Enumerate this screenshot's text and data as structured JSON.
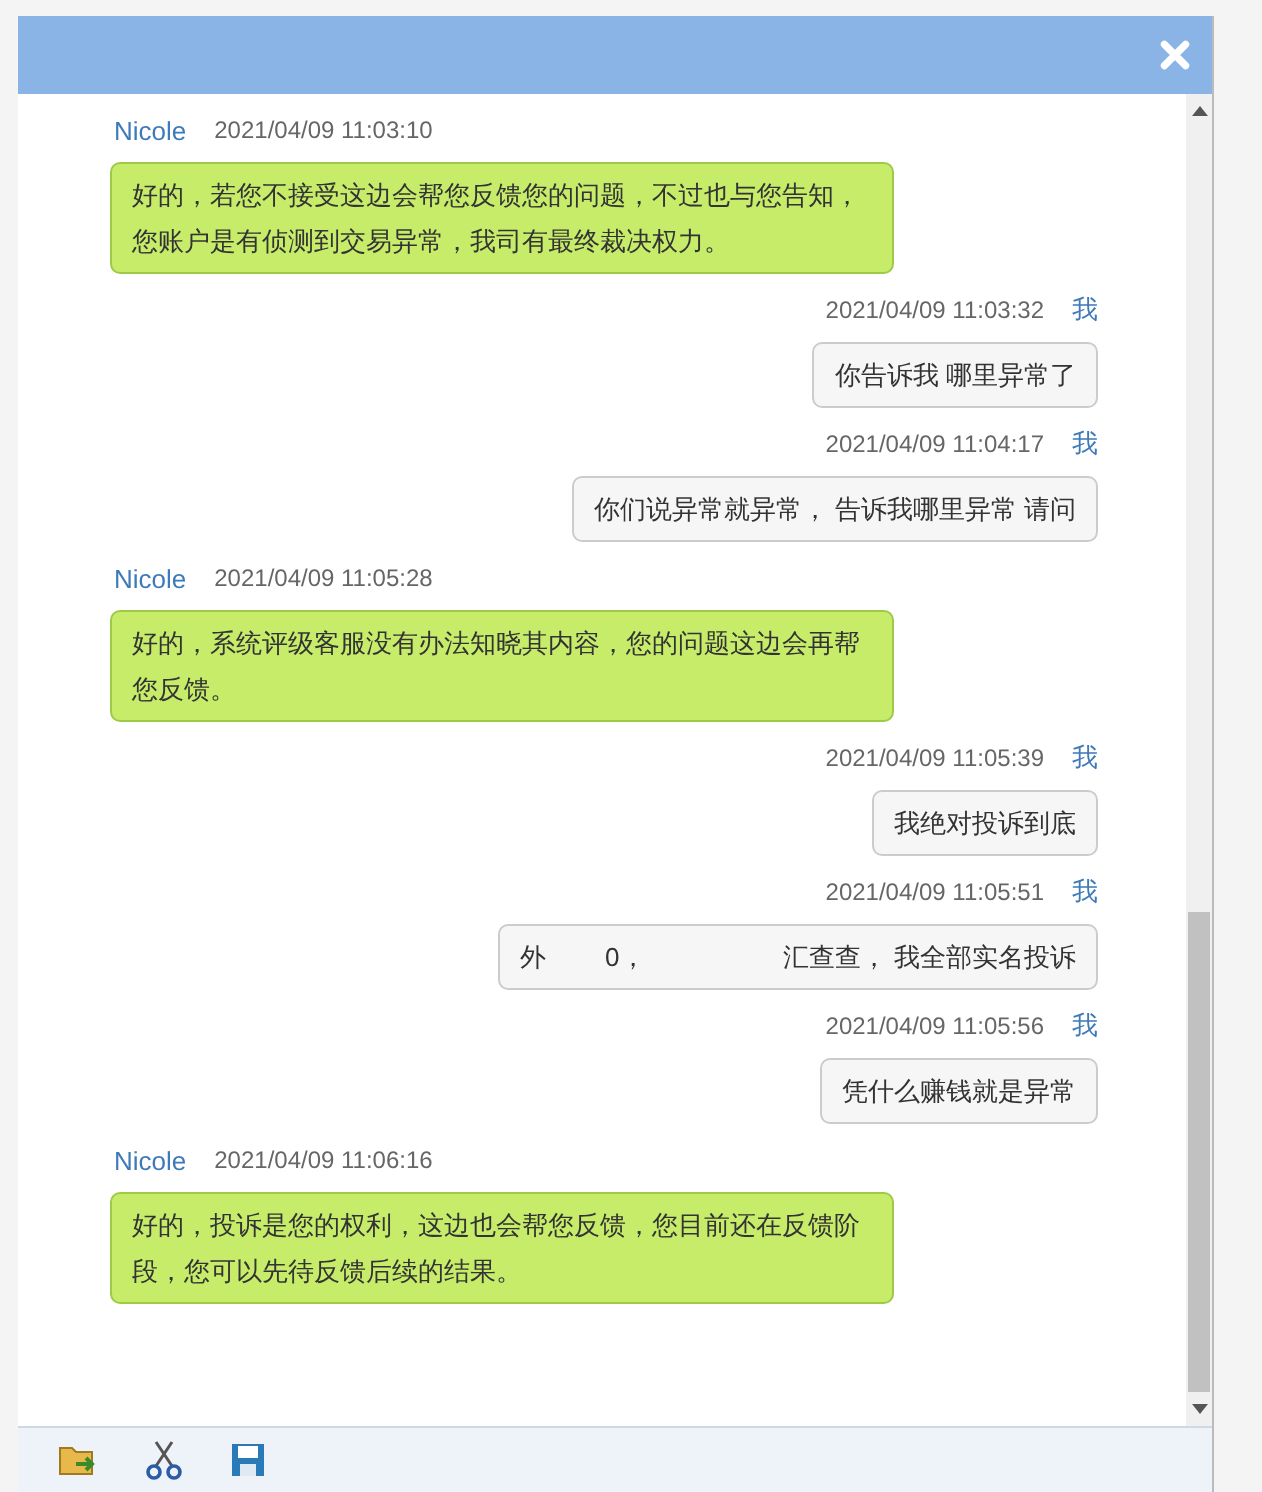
{
  "messages": [
    {
      "kind": "agent",
      "sender": "Nicole",
      "time": "2021/04/09 11:03:10",
      "text": "好的，若您不接受这边会帮您反馈您的问题，不过也与您告知，您账户是有侦测到交易异常，我司有最终裁决权力。"
    },
    {
      "kind": "me",
      "sender": "我",
      "time": "2021/04/09 11:03:32",
      "text": "你告诉我 哪里异常了"
    },
    {
      "kind": "me",
      "sender": "我",
      "time": "2021/04/09 11:04:17",
      "text": "你们说异常就异常， 告诉我哪里异常 请问"
    },
    {
      "kind": "agent",
      "sender": "Nicole",
      "time": "2021/04/09 11:05:28",
      "text": "好的，系统评级客服没有办法知晓其内容，您的问题这边会再帮您反馈。"
    },
    {
      "kind": "me",
      "sender": "我",
      "time": "2021/04/09 11:05:39",
      "text": "我绝对投诉到底"
    },
    {
      "kind": "me",
      "sender": "我",
      "time": "2021/04/09 11:05:51",
      "text": "外　　 0，　　　　　 汇查查， 我全部实名投诉"
    },
    {
      "kind": "me",
      "sender": "我",
      "time": "2021/04/09 11:05:56",
      "text": "凭什么赚钱就是异常"
    },
    {
      "kind": "agent",
      "sender": "Nicole",
      "time": "2021/04/09 11:06:16",
      "text": "好的，投诉是您的权利，这边也会帮您反馈，您目前还在反馈阶段，您可以先待反馈后续的结果。"
    }
  ]
}
